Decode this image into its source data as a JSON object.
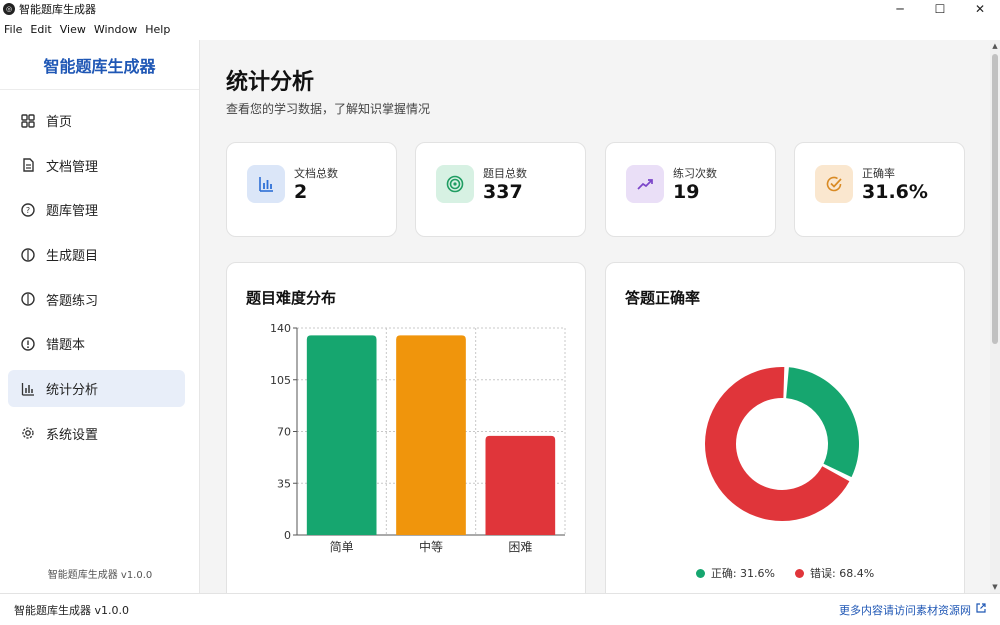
{
  "window": {
    "title": "智能题库生成器",
    "minimize": "─",
    "maximize": "☐",
    "close": "✕"
  },
  "menu": [
    "File",
    "Edit",
    "View",
    "Window",
    "Help"
  ],
  "sidebar": {
    "brand": "智能题库生成器",
    "items": [
      {
        "label": "首页",
        "icon": "grid-icon"
      },
      {
        "label": "文档管理",
        "icon": "document-icon"
      },
      {
        "label": "题库管理",
        "icon": "question-icon"
      },
      {
        "label": "生成题目",
        "icon": "lightbulb-icon"
      },
      {
        "label": "答题练习",
        "icon": "lightbulb-icon"
      },
      {
        "label": "错题本",
        "icon": "alert-icon"
      },
      {
        "label": "统计分析",
        "icon": "bar-chart-icon",
        "active": true
      },
      {
        "label": "系统设置",
        "icon": "gear-icon"
      }
    ],
    "footer": "智能题库生成器 v1.0.0"
  },
  "page": {
    "title": "统计分析",
    "subtitle": "查看您的学习数据，了解知识掌握情况"
  },
  "stats": [
    {
      "label": "文档总数",
      "value": "2",
      "icon": "bar-chart-icon",
      "color": "#2d6fd6",
      "bg": "#dbe6f8"
    },
    {
      "label": "题目总数",
      "value": "337",
      "icon": "target-icon",
      "color": "#1f9d62",
      "bg": "#d7f1e3"
    },
    {
      "label": "练习次数",
      "value": "19",
      "icon": "trend-up-icon",
      "color": "#7b45c9",
      "bg": "#eadff7"
    },
    {
      "label": "正确率",
      "value": "31.6%",
      "icon": "check-circle-icon",
      "color": "#d98a23",
      "bg": "#fae7cf"
    }
  ],
  "panels": {
    "difficulty_title": "题目难度分布",
    "accuracy_title": "答题正确率"
  },
  "chart_data": [
    {
      "type": "bar",
      "title": "题目难度分布",
      "categories": [
        "简单",
        "中等",
        "困难"
      ],
      "values": [
        135,
        135,
        67
      ],
      "colors": [
        "#16a66f",
        "#f0950c",
        "#e0353a"
      ],
      "ylim": [
        0,
        140
      ],
      "yticks": [
        0,
        35,
        70,
        105,
        140
      ],
      "grid": true
    },
    {
      "type": "pie",
      "title": "答题正确率",
      "donut": true,
      "slices": [
        {
          "label": "正确",
          "value": 31.6,
          "color": "#16a66f"
        },
        {
          "label": "错误",
          "value": 68.4,
          "color": "#e0353a"
        }
      ],
      "legend_texts": [
        "正确: 31.6%",
        "错误: 68.4%"
      ],
      "legend_position": "bottom"
    }
  ],
  "statusbar": {
    "left": "智能题库生成器 v1.0.0",
    "link": "更多内容请访问素材资源网"
  }
}
